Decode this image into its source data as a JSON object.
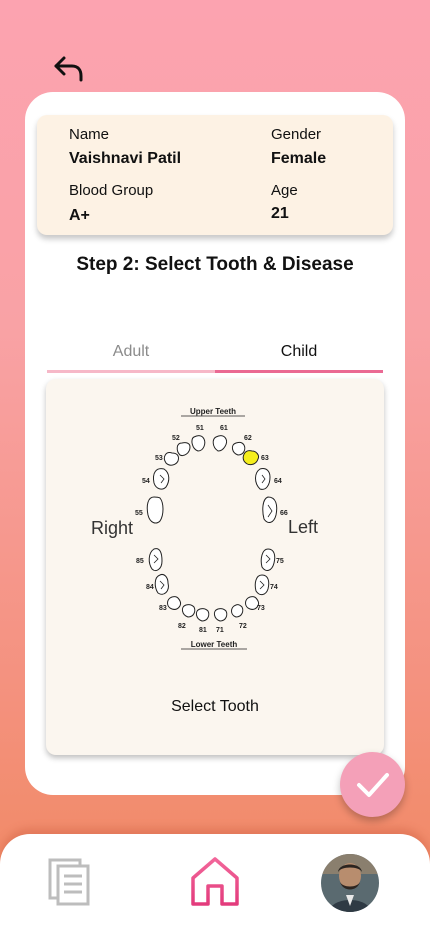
{
  "patient": {
    "name_label": "Name",
    "name_value": "Vaishnavi Patil",
    "gender_label": "Gender",
    "gender_value": "Female",
    "blood_group_label": "Blood Group",
    "blood_group_value": "A+",
    "age_label": "Age",
    "age_value": "21"
  },
  "step_title": "Step 2: Select Tooth & Disease",
  "tabs": [
    {
      "label": "Adult",
      "active": false
    },
    {
      "label": "Child",
      "active": true
    }
  ],
  "tooth_chart": {
    "upper_label": "Upper Teeth",
    "lower_label": "Lower Teeth",
    "right_label": "Right",
    "left_label": "Left",
    "upper_numbers": [
      "55",
      "54",
      "53",
      "52",
      "51",
      "61",
      "62",
      "63",
      "64",
      "66"
    ],
    "lower_numbers": [
      "85",
      "84",
      "83",
      "82",
      "81",
      "71",
      "72",
      "73",
      "74",
      "75"
    ],
    "selected_tooth": "63",
    "selected_color": "#f5ee1d",
    "select_label": "Select Tooth"
  },
  "nav": {
    "left_icon": "documents-icon",
    "center_icon": "home-icon",
    "right_icon": "profile-avatar",
    "accent": "#ea4f8a"
  },
  "colors": {
    "accent_pink": "#ea6a94",
    "confirm_button": "#f4a0b8",
    "patient_card": "#fdf2e4"
  }
}
